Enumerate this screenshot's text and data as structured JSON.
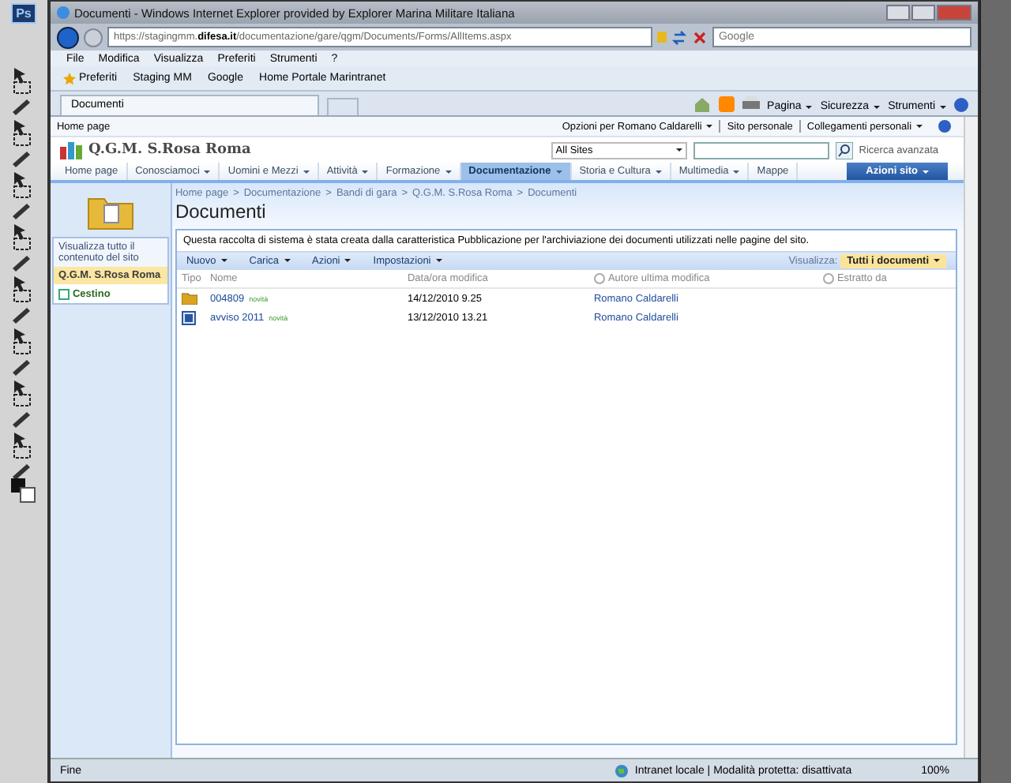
{
  "photoshop": {
    "logo": "Ps"
  },
  "window": {
    "title": "Documenti - Windows Internet Explorer provided by Explorer Marina Militare Italiana"
  },
  "address_bar": {
    "url_prefix": "https://stagingmm.",
    "url_domain": "difesa.it",
    "url_path": "/documentazione/gare/qgm/Documents/Forms/AllItems.aspx"
  },
  "search_box": {
    "placeholder": "Google"
  },
  "menu": [
    "File",
    "Modifica",
    "Visualizza",
    "Preferiti",
    "Strumenti",
    "?"
  ],
  "favorites_bar": {
    "button": "Preferiti",
    "links": [
      "Staging MM",
      "Google",
      "Home Portale Marintranet"
    ]
  },
  "tabs": [
    {
      "label": "Documenti",
      "selected": true
    }
  ],
  "command_bar": [
    "Pagina",
    "Sicurezza",
    "Strumenti"
  ],
  "page": {
    "top_links": {
      "left": "Home page",
      "right": [
        {
          "label": "Opzioni per Romano Caldarelli",
          "has_menu": true
        },
        {
          "label": "Sito personale",
          "has_menu": false
        },
        {
          "label": "Collegamenti personali",
          "has_menu": true
        }
      ]
    },
    "site_title": "Q.G.M. S.Rosa Roma",
    "search": {
      "scope": "All Sites",
      "advanced": "Ricerca avanzata"
    },
    "nav": [
      {
        "label": "Home page",
        "has_menu": false,
        "selected": false
      },
      {
        "label": "Conosciamoci",
        "has_menu": true,
        "selected": false
      },
      {
        "label": "Uomini e Mezzi",
        "has_menu": true,
        "selected": false
      },
      {
        "label": "Attività",
        "has_menu": true,
        "selected": false
      },
      {
        "label": "Formazione",
        "has_menu": true,
        "selected": false
      },
      {
        "label": "Documentazione",
        "has_menu": true,
        "selected": true
      },
      {
        "label": "Storia e Cultura",
        "has_menu": true,
        "selected": false
      },
      {
        "label": "Multimedia",
        "has_menu": true,
        "selected": false
      },
      {
        "label": "Mappe",
        "has_menu": false,
        "selected": false
      }
    ],
    "site_actions": "Azioni sito",
    "breadcrumb": [
      "Home page",
      "Documentazione",
      "Bandi di gara",
      "Q.G.M. S.Rosa Roma",
      "Documenti"
    ],
    "breadcrumb_separator": ">",
    "heading": "Documenti",
    "quick_launch": {
      "view_all": "Visualizza tutto il contenuto del sito",
      "items": [
        {
          "label": "Q.G.M. S.Rosa Roma",
          "selected": true,
          "kind": "site"
        },
        {
          "label": "Cestino",
          "selected": false,
          "kind": "recycle"
        }
      ]
    },
    "description": "Questa raccolta di sistema è stata creata dalla caratteristica Pubblicazione per l'archiviazione dei documenti utilizzati nelle pagine del sito.",
    "toolbar": [
      "Nuovo",
      "Carica",
      "Azioni",
      "Impostazioni"
    ],
    "view": {
      "label": "Visualizza:",
      "value": "Tutti i documenti"
    },
    "table": {
      "columns": [
        {
          "label": "Tipo",
          "filter": false
        },
        {
          "label": "Nome",
          "filter": false
        },
        {
          "label": "Data/ora modifica",
          "filter": false
        },
        {
          "label": "Autore ultima modifica",
          "filter": true
        },
        {
          "label": "Estratto da",
          "filter": true
        }
      ],
      "rows": [
        {
          "kind": "folder",
          "name": "004809",
          "badge": "novità",
          "modified": "14/12/2010 9.25",
          "author": "Romano Caldarelli"
        },
        {
          "kind": "document",
          "name": "avviso 2011",
          "badge": "novità",
          "modified": "13/12/2010 13.21",
          "author": "Romano Caldarelli"
        }
      ]
    }
  },
  "status_bar": {
    "text": "Fine",
    "zone": "Intranet locale | Modalità protetta: disattivata",
    "zoom": "100%"
  }
}
